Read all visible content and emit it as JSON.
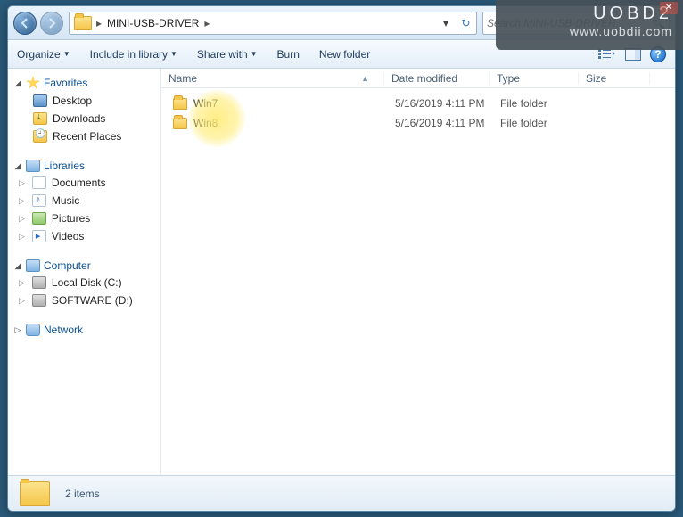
{
  "watermark": {
    "line1": "UOBD2",
    "line2": "www.uobdii.com"
  },
  "nav": {
    "back_icon": "arrow-left-icon",
    "forward_icon": "arrow-right-icon",
    "crumb1": "MINI-USB-DRIVER",
    "refresh_icon": "refresh-icon",
    "search_placeholder": "Search MINI-USB-DRIVER"
  },
  "toolbar": {
    "organize": "Organize",
    "include": "Include in library",
    "share": "Share with",
    "burn": "Burn",
    "newfolder": "New folder"
  },
  "sidebar": {
    "favorites": {
      "label": "Favorites",
      "items": [
        {
          "label": "Desktop"
        },
        {
          "label": "Downloads"
        },
        {
          "label": "Recent Places"
        }
      ]
    },
    "libraries": {
      "label": "Libraries",
      "items": [
        {
          "label": "Documents"
        },
        {
          "label": "Music"
        },
        {
          "label": "Pictures"
        },
        {
          "label": "Videos"
        }
      ]
    },
    "computer": {
      "label": "Computer",
      "items": [
        {
          "label": "Local Disk (C:)"
        },
        {
          "label": "SOFTWARE (D:)"
        }
      ]
    },
    "network": {
      "label": "Network"
    }
  },
  "columns": {
    "name": "Name",
    "date": "Date modified",
    "type": "Type",
    "size": "Size"
  },
  "rows": [
    {
      "name": "Win7",
      "date": "5/16/2019 4:11 PM",
      "type": "File folder",
      "size": ""
    },
    {
      "name": "Win8",
      "date": "5/16/2019 4:11 PM",
      "type": "File folder",
      "size": ""
    }
  ],
  "status": {
    "count": "2 items"
  }
}
